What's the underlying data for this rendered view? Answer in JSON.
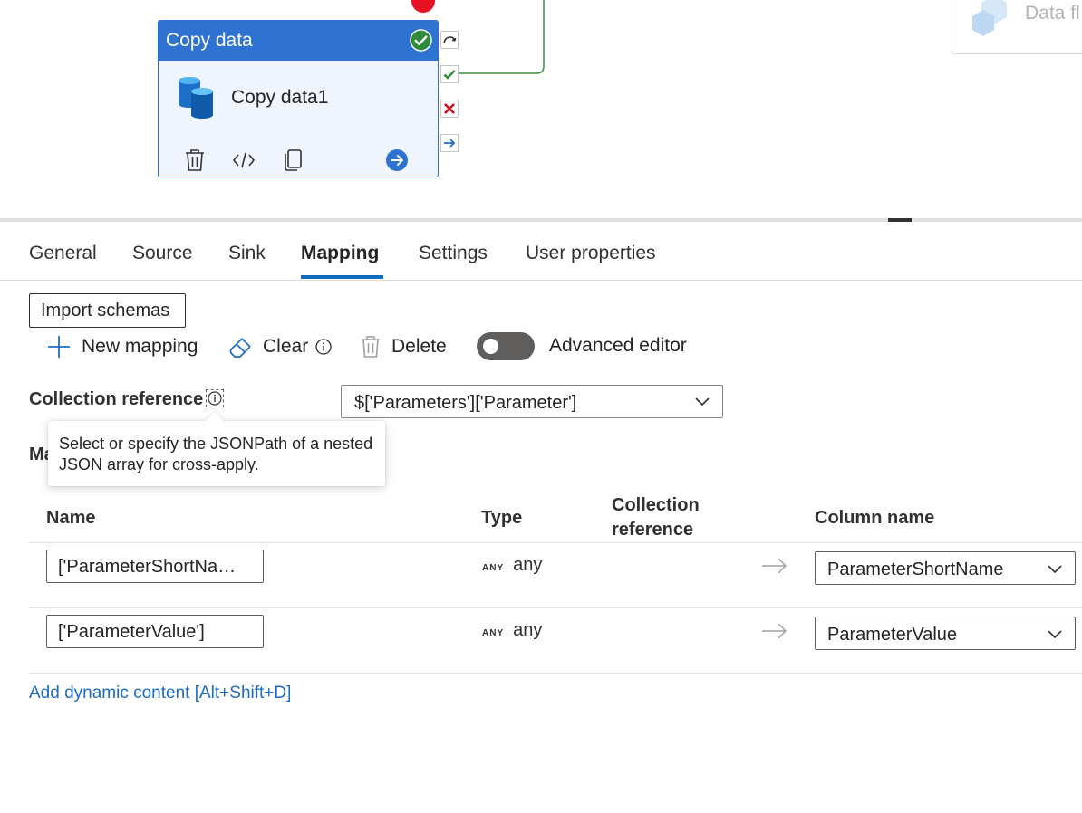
{
  "canvas": {
    "activity_type": "Copy data",
    "activity_name": "Copy data1",
    "dataflow_label": "Data fl"
  },
  "tabs": [
    {
      "label": "General"
    },
    {
      "label": "Source"
    },
    {
      "label": "Sink"
    },
    {
      "label": "Mapping",
      "active": true
    },
    {
      "label": "Settings"
    },
    {
      "label": "User properties"
    }
  ],
  "toolbar": {
    "import_schemas": "Import schemas",
    "new_mapping": "New mapping",
    "clear": "Clear",
    "delete": "Delete",
    "advanced_editor": "Advanced editor",
    "advanced_editor_on": false
  },
  "collection_reference": {
    "label": "Collection reference",
    "value": "$['Parameters']['Parameter']",
    "tooltip": "Select or specify the JSONPath of a nested JSON array for cross-apply."
  },
  "mapping_section_label": "Ma",
  "table": {
    "headers": {
      "name": "Name",
      "type": "Type",
      "collection_reference_line1": "Collection",
      "collection_reference_line2": "reference",
      "column_name": "Column name"
    },
    "rows": [
      {
        "name": "['ParameterShortNa…",
        "type_badge": "ANY",
        "type": "any",
        "column": "ParameterShortName"
      },
      {
        "name": "['ParameterValue']",
        "type_badge": "ANY",
        "type": "any",
        "column": "ParameterValue"
      }
    ]
  },
  "add_dynamic_content": "Add dynamic content [Alt+Shift+D]",
  "colors": {
    "accent": "#0f6cbd",
    "activity_header": "#2f73d2",
    "success": "#2e8b3a",
    "failure": "#c50f1f",
    "link": "#1b6ac9"
  }
}
